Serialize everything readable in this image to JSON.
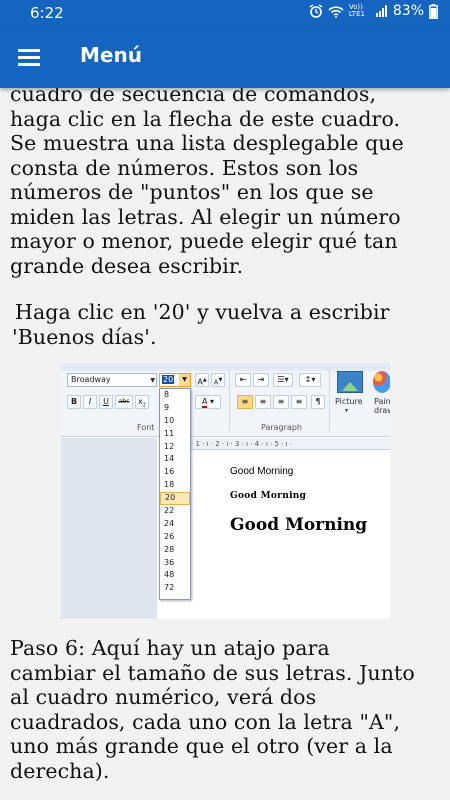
{
  "status_bar": {
    "time": "6:22",
    "network": "Vo)) LTE1",
    "battery": "83%"
  },
  "app_bar": {
    "title": "Menú",
    "menu_icon": "hamburger-menu-icon"
  },
  "content": {
    "paragraph_1_lines": [
      "cuadro de secuencia de comandos,",
      "haga clic en la flecha de este cuadro.",
      "Se muestra una lista desplegable que",
      "consta de números. Estos son los",
      "números de \"puntos\" en los que se",
      "miden las letras. Al elegir un número",
      "mayor o menor, puede elegir qué tan",
      "grande desea escribir."
    ],
    "paragraph_2_lines": [
      "Haga clic en '20' y vuelva a escribir",
      "'Buenos días'."
    ],
    "paragraph_3_lines": [
      " Paso 6: Aquí hay un atajo para",
      "cambiar el tamaño de sus letras. Junto",
      "al cuadro numérico, verá dos",
      "cuadrados, cada uno con la letra \"A\",",
      "uno más grande que el otro (ver a la",
      "derecha)."
    ]
  },
  "screenshot": {
    "font_name": "Broadway",
    "font_size": "20",
    "size_options": [
      "8",
      "9",
      "10",
      "11",
      "12",
      "14",
      "16",
      "18",
      "20",
      "22",
      "24",
      "26",
      "28",
      "36",
      "48",
      "72"
    ],
    "selected_size": "20",
    "group_font": "Font",
    "group_paragraph": "Paragraph",
    "picture_label": "Picture",
    "paint_label": "Paint drawi",
    "ruler": "· 1 · ı · 2 · ı · 3 · ı · 4 · ı · 5 · ı ·",
    "doc_lines": [
      "Good Morning",
      "Good Morning",
      "Good Morning"
    ]
  }
}
